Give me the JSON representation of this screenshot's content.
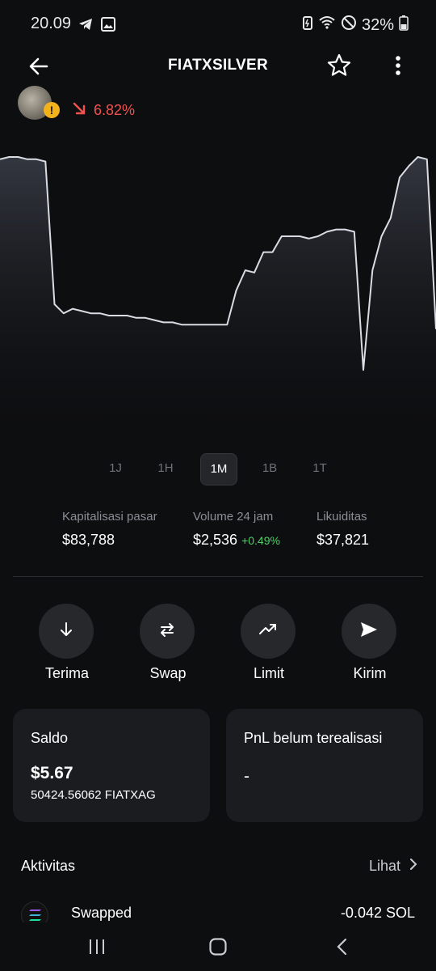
{
  "status_bar": {
    "time": "20.09",
    "battery": "32%",
    "icons": [
      "telegram-icon",
      "gallery-icon",
      "battery-saver-icon",
      "wifi-icon",
      "do-not-disturb-icon",
      "battery-icon"
    ]
  },
  "header": {
    "title": "FIATXSILVER",
    "back_icon": "arrow-left-icon",
    "favorite_icon": "star-outline-icon",
    "more_icon": "vertical-dots-icon"
  },
  "token": {
    "change": "6.82%",
    "change_direction": "down",
    "warning_badge": "!",
    "colors": {
      "negative": "#f0524f",
      "positive": "#4fd06b",
      "warning": "#f2b21b"
    }
  },
  "chart_data": {
    "type": "area",
    "values": [
      0.94,
      0.95,
      0.95,
      0.94,
      0.94,
      0.93,
      0.3,
      0.26,
      0.28,
      0.27,
      0.26,
      0.26,
      0.25,
      0.25,
      0.25,
      0.24,
      0.24,
      0.23,
      0.22,
      0.22,
      0.21,
      0.21,
      0.21,
      0.21,
      0.21,
      0.21,
      0.36,
      0.45,
      0.44,
      0.53,
      0.53,
      0.6,
      0.6,
      0.6,
      0.59,
      0.6,
      0.62,
      0.63,
      0.63,
      0.62,
      0.01,
      0.45,
      0.6,
      0.68,
      0.86,
      0.91,
      0.95,
      0.94,
      0.19
    ]
  },
  "ranges": {
    "items": [
      "1J",
      "1H",
      "1M",
      "1B",
      "1T"
    ],
    "active": "1M"
  },
  "stats": {
    "market_cap_label": "Kapitalisasi pasar",
    "market_cap_value": "$83,788",
    "volume_label": "Volume 24 jam",
    "volume_value": "$2,536",
    "volume_change": "+0.49%",
    "liquidity_label": "Likuiditas",
    "liquidity_value": "$37,821"
  },
  "actions": [
    {
      "label": "Terima",
      "icon": "arrow-down-icon"
    },
    {
      "label": "Swap",
      "icon": "swap-icon"
    },
    {
      "label": "Limit",
      "icon": "trend-up-icon"
    },
    {
      "label": "Kirim",
      "icon": "send-icon"
    }
  ],
  "balance_card": {
    "title": "Saldo",
    "value": "$5.67",
    "amount": "50424.56062 FIATXAG"
  },
  "pnl_card": {
    "title": "PnL belum terealisasi",
    "value": "-"
  },
  "activity": {
    "title": "Aktivitas",
    "link": "Lihat",
    "items": [
      {
        "label": "Swapped",
        "amount": "-0.042 SOL",
        "icon": "solana-icon"
      }
    ]
  },
  "navbar": {
    "icons": [
      "recent-apps-icon",
      "home-icon",
      "back-icon"
    ]
  }
}
